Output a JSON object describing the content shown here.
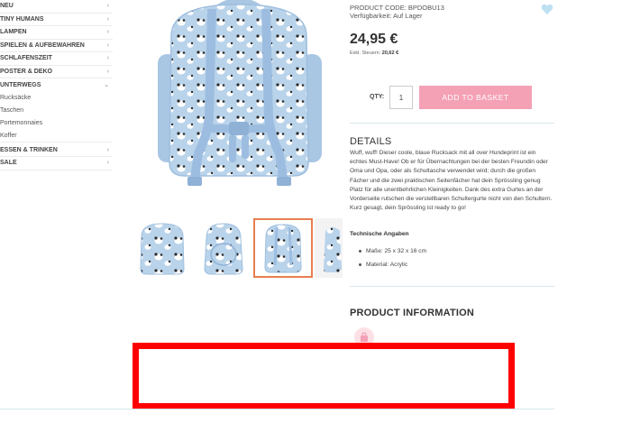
{
  "sidebar": {
    "items": [
      {
        "label": "NEU",
        "chevron": "›"
      },
      {
        "label": "TINY HUMANS",
        "chevron": "›"
      },
      {
        "label": "LAMPEN",
        "chevron": "›"
      },
      {
        "label": "SPIELEN & AUFBEWAHREN",
        "chevron": "›"
      },
      {
        "label": "SCHLAFENSZEIT",
        "chevron": "›"
      },
      {
        "label": "POSTER & DEKO",
        "chevron": "›"
      },
      {
        "label": "UNTERWEGS",
        "chevron": "⌄"
      }
    ],
    "sub_items": [
      "Rucksäcke",
      "Taschen",
      "Portemonnaies",
      "Koffer"
    ],
    "items_after": [
      {
        "label": "ESSEN & TRINKEN",
        "chevron": "›"
      },
      {
        "label": "SALE",
        "chevron": "›"
      }
    ]
  },
  "product": {
    "code": "PRODUCT CODE: BPDOBU13",
    "availability": "Verfügbarkeit: Auf Lager",
    "price": "24,95 €",
    "excl_label": "Exkl. Steuern:",
    "excl_value": "20,62 €",
    "qty_label": "QTY:",
    "qty_value": "1",
    "add_to_basket": "ADD TO BASKET"
  },
  "details": {
    "heading": "DETAILS",
    "description": "Wuff, wuff! Dieser coole, blaue Rucksack mit all over Hundeprint ist ein echtes Must-Have! Ob er für Übernachtungen bei der besten Freundin oder Oma und Opa, oder als Schultasche verwendet wird; durch die großen Fächer und die zwei praktischen Seitenfächer hat dein Sprössling genug Platz für alle unentbehrlichen Kleinigkeiten. Dank des extra Gurtes an der Vorderseite rutschen die verstellbaren Schultergurte nicht von den Schultern. Kurz gesagt, dein Sprössling ist ready to go!",
    "tech_title": "Technische Angaben",
    "specs": [
      "Maße: 25 x 32 x 16 cm",
      "Material: Acrylic"
    ]
  },
  "info": {
    "heading": "PRODUCT INFORMATION"
  },
  "colors": {
    "accent_pink": "#f4a1b6",
    "backpack_blue": "#b9d3ea",
    "active_thumb_border": "#e87f4f",
    "highlight_red": "#ff0000"
  },
  "icons": {
    "heart": "heart-icon",
    "info": "pink-bag-icon"
  }
}
